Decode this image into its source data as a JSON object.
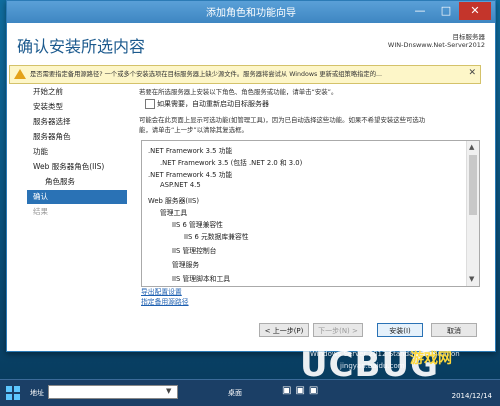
{
  "window": {
    "title": "添加角色和功能向导",
    "controls": {
      "minimize": "—",
      "maximize": "□",
      "close": "✕"
    }
  },
  "header": {
    "page_title": "确认安装所选内容",
    "target_label": "目标服务器",
    "target_name": "WIN-Dnswww.Net-Server2012"
  },
  "warning": {
    "text": "是否需要指定备用源路径? 一个或多个安装选项在目标服务器上缺少源文件。服务器将尝试从 Windows 更新或组策略指定的...",
    "close": "✕",
    "color": "#fdf6c8"
  },
  "sidebar": {
    "items": [
      {
        "label": "开始之前",
        "state": "normal"
      },
      {
        "label": "安装类型",
        "state": "normal"
      },
      {
        "label": "服务器选择",
        "state": "normal"
      },
      {
        "label": "服务器角色",
        "state": "normal"
      },
      {
        "label": "功能",
        "state": "normal"
      },
      {
        "label": "Web 服务器角色(IIS)",
        "state": "normal"
      },
      {
        "label": "角色服务",
        "state": "normal"
      },
      {
        "label": "确认",
        "state": "active"
      },
      {
        "label": "结果",
        "state": "disabled"
      }
    ]
  },
  "content": {
    "intro": "若要在所选服务器上安装以下角色、角色服务或功能，请单击“安装”。",
    "checkbox_label": "如果需要，自动重新启动目标服务器",
    "note_line1": "可能会在此页面上显示可选功能(如管理工具)，因为已自动选择这些功能。如果不希望安装这些可选功",
    "note_line2": "能，请单击“上一步”以清除其复选框。",
    "list": [
      ".NET Framework 3.5 功能",
      ".NET Framework 3.5 (包括 .NET 2.0 和 3.0)",
      ".NET Framework 4.5 功能",
      "ASP.NET 4.5",
      "Web 服务器(IIS)",
      "管理工具",
      "IIS 6 管理兼容性",
      "IIS 6 元数据库兼容性",
      "IIS 管理控制台",
      "管理服务",
      "IIS 管理脚本和工具"
    ],
    "export_link": "导出配置设置",
    "alt_source_link": "指定备用源路径"
  },
  "buttons": {
    "prev": "< 上一步(P)",
    "next": "下一步(N) >",
    "install": "安装(I)",
    "cancel": "取消"
  },
  "desktop_status": {
    "line1": "Windows Server 2012 Standard Evaluation",
    "line2": "jingyan.baidu.com"
  },
  "taskbar": {
    "address_label": "地址",
    "desktop_label": "桌面",
    "date": "2014/12/14"
  },
  "watermark": {
    "text_main": "UCBUG",
    "text_sub": "游戏网",
    "url": ".com"
  },
  "colors": {
    "accent": "#2a72b5",
    "title_text": "#1c5a8e",
    "link": "#1d5fb0",
    "watermark_red": "#e8321f"
  }
}
